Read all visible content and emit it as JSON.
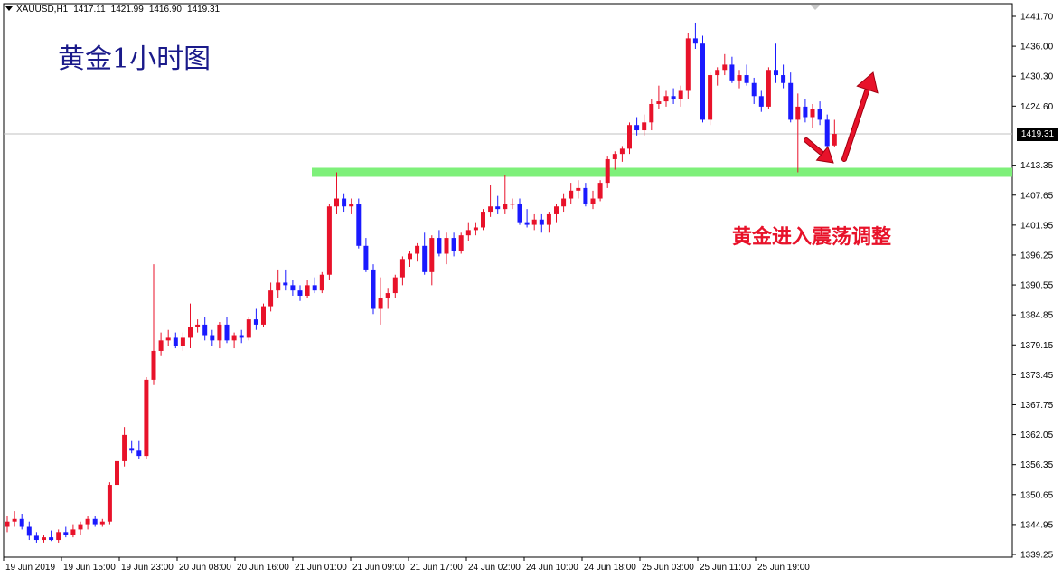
{
  "header": {
    "symbol": "XAUUSD,H1",
    "open": "1417.11",
    "high": "1421.99",
    "low": "1416.90",
    "close": "1419.31"
  },
  "title": "黄金1小时图",
  "annotation": "黄金进入震荡调整",
  "current_price_label": "1419.31",
  "colors": {
    "bull": "#e8122a",
    "bear": "#1a1aff",
    "support_line": "#7ef07a",
    "arrow": "#e8122a",
    "title": "#1a1a8a",
    "price_line": "#c0c0c0"
  },
  "chart_data": {
    "type": "candlestick",
    "y_axis": {
      "min": 1338.0,
      "max": 1443.0,
      "ticks": [
        1441.7,
        1436.0,
        1430.3,
        1424.6,
        1419.31,
        1413.35,
        1407.65,
        1401.95,
        1396.25,
        1390.55,
        1384.85,
        1379.15,
        1373.45,
        1367.75,
        1362.05,
        1356.35,
        1350.65,
        1344.95,
        1339.25
      ],
      "tick_labels": [
        "1441.70",
        "1436.00",
        "1430.30",
        "1424.60",
        "1419.31",
        "1413.35",
        "1407.65",
        "1401.95",
        "1396.25",
        "1390.55",
        "1384.85",
        "1379.15",
        "1373.45",
        "1367.75",
        "1362.05",
        "1356.35",
        "1350.65",
        "1344.95",
        "1339.25"
      ]
    },
    "x_axis": {
      "tick_labels": [
        "19 Jun 2019",
        "19 Jun 15:00",
        "19 Jun 23:00",
        "20 Jun 08:00",
        "20 Jun 16:00",
        "21 Jun 01:00",
        "21 Jun 09:00",
        "21 Jun 17:00",
        "24 Jun 02:00",
        "24 Jun 10:00",
        "24 Jun 18:00",
        "25 Jun 03:00",
        "25 Jun 11:00",
        "25 Jun 19:00"
      ],
      "tick_bar_index": [
        0,
        8,
        16,
        24,
        32,
        40,
        48,
        56,
        64,
        72,
        80,
        88,
        96,
        104
      ]
    },
    "support_level": 1412.0,
    "current_price": 1419.31,
    "candles": [
      [
        1344.5,
        1346.5,
        1343.5,
        1345.5
      ],
      [
        1345.5,
        1347.5,
        1344.5,
        1346.0
      ],
      [
        1346.0,
        1347.0,
        1344.0,
        1344.5
      ],
      [
        1344.5,
        1345.5,
        1342.0,
        1342.8
      ],
      [
        1342.8,
        1343.5,
        1341.5,
        1342.0
      ],
      [
        1342.0,
        1343.0,
        1341.5,
        1342.5
      ],
      [
        1342.5,
        1343.8,
        1341.8,
        1342.0
      ],
      [
        1342.0,
        1344.0,
        1341.5,
        1343.5
      ],
      [
        1343.5,
        1344.5,
        1342.5,
        1343.0
      ],
      [
        1343.0,
        1345.0,
        1342.5,
        1344.0
      ],
      [
        1344.0,
        1345.5,
        1343.0,
        1345.0
      ],
      [
        1345.0,
        1346.5,
        1344.0,
        1346.0
      ],
      [
        1346.0,
        1346.5,
        1344.5,
        1345.0
      ],
      [
        1345.0,
        1346.0,
        1344.5,
        1345.5
      ],
      [
        1345.5,
        1353.0,
        1345.0,
        1352.5
      ],
      [
        1352.5,
        1357.5,
        1351.5,
        1357.0
      ],
      [
        1357.0,
        1363.5,
        1356.0,
        1362.0
      ],
      [
        1359.5,
        1361.0,
        1358.5,
        1359.0
      ],
      [
        1359.0,
        1361.0,
        1357.5,
        1358.0
      ],
      [
        1358.0,
        1373.0,
        1357.5,
        1372.5
      ],
      [
        1372.5,
        1394.5,
        1371.5,
        1378.0
      ],
      [
        1378.0,
        1381.5,
        1377.0,
        1380.0
      ],
      [
        1380.0,
        1382.0,
        1379.0,
        1380.5
      ],
      [
        1380.5,
        1381.5,
        1378.5,
        1379.0
      ],
      [
        1379.0,
        1381.5,
        1378.0,
        1380.5
      ],
      [
        1380.5,
        1387.0,
        1378.5,
        1382.5
      ],
      [
        1382.5,
        1384.0,
        1381.5,
        1383.0
      ],
      [
        1383.0,
        1384.5,
        1380.0,
        1381.0
      ],
      [
        1381.0,
        1382.0,
        1379.0,
        1380.0
      ],
      [
        1380.0,
        1383.5,
        1378.5,
        1383.0
      ],
      [
        1383.0,
        1384.5,
        1379.5,
        1380.0
      ],
      [
        1380.0,
        1381.5,
        1378.5,
        1381.0
      ],
      [
        1381.0,
        1382.0,
        1379.5,
        1380.5
      ],
      [
        1380.5,
        1384.5,
        1380.0,
        1384.0
      ],
      [
        1384.0,
        1386.0,
        1382.0,
        1383.0
      ],
      [
        1383.0,
        1387.0,
        1382.5,
        1386.5
      ],
      [
        1386.5,
        1391.0,
        1385.5,
        1389.5
      ],
      [
        1389.5,
        1393.5,
        1388.0,
        1391.0
      ],
      [
        1391.0,
        1393.5,
        1389.5,
        1390.5
      ],
      [
        1390.5,
        1391.5,
        1388.5,
        1389.5
      ],
      [
        1389.5,
        1390.5,
        1387.5,
        1388.5
      ],
      [
        1388.5,
        1391.5,
        1388.0,
        1390.5
      ],
      [
        1390.5,
        1392.0,
        1389.0,
        1389.5
      ],
      [
        1389.5,
        1393.0,
        1389.0,
        1392.5
      ],
      [
        1392.5,
        1406.0,
        1391.5,
        1405.5
      ],
      [
        1405.5,
        1412.0,
        1404.0,
        1407.0
      ],
      [
        1407.0,
        1408.0,
        1404.5,
        1405.5
      ],
      [
        1405.5,
        1407.0,
        1404.0,
        1406.0
      ],
      [
        1406.0,
        1407.0,
        1397.5,
        1398.0
      ],
      [
        1398.0,
        1399.5,
        1393.0,
        1393.5
      ],
      [
        1393.5,
        1394.5,
        1385.0,
        1386.0
      ],
      [
        1386.0,
        1392.0,
        1383.0,
        1388.0
      ],
      [
        1388.0,
        1390.0,
        1386.0,
        1389.0
      ],
      [
        1389.0,
        1392.5,
        1388.0,
        1392.0
      ],
      [
        1392.0,
        1396.0,
        1390.5,
        1395.5
      ],
      [
        1395.5,
        1397.0,
        1394.0,
        1396.5
      ],
      [
        1396.5,
        1398.5,
        1395.0,
        1398.0
      ],
      [
        1398.0,
        1400.5,
        1392.5,
        1393.0
      ],
      [
        1393.0,
        1400.0,
        1390.5,
        1399.5
      ],
      [
        1399.5,
        1401.0,
        1396.0,
        1396.5
      ],
      [
        1396.5,
        1400.5,
        1394.5,
        1399.5
      ],
      [
        1399.5,
        1400.5,
        1396.0,
        1397.0
      ],
      [
        1397.0,
        1400.5,
        1396.5,
        1400.0
      ],
      [
        1400.0,
        1402.5,
        1399.0,
        1401.0
      ],
      [
        1401.0,
        1402.5,
        1400.0,
        1401.5
      ],
      [
        1401.5,
        1405.0,
        1401.0,
        1404.5
      ],
      [
        1404.5,
        1409.5,
        1403.5,
        1405.5
      ],
      [
        1405.5,
        1407.5,
        1404.0,
        1405.0
      ],
      [
        1405.0,
        1411.5,
        1404.0,
        1406.0
      ],
      [
        1406.0,
        1407.0,
        1405.0,
        1406.0
      ],
      [
        1406.0,
        1407.0,
        1402.0,
        1402.5
      ],
      [
        1402.5,
        1405.0,
        1401.5,
        1402.0
      ],
      [
        1402.0,
        1404.0,
        1401.0,
        1403.0
      ],
      [
        1403.0,
        1404.0,
        1400.5,
        1402.0
      ],
      [
        1402.0,
        1404.5,
        1400.5,
        1404.0
      ],
      [
        1404.0,
        1406.0,
        1402.5,
        1405.5
      ],
      [
        1405.5,
        1408.0,
        1404.5,
        1407.0
      ],
      [
        1407.0,
        1410.0,
        1406.0,
        1408.5
      ],
      [
        1408.5,
        1410.5,
        1407.0,
        1409.0
      ],
      [
        1409.0,
        1410.0,
        1405.5,
        1406.0
      ],
      [
        1406.0,
        1408.5,
        1405.0,
        1407.0
      ],
      [
        1407.0,
        1410.5,
        1406.5,
        1410.0
      ],
      [
        1410.0,
        1415.0,
        1409.0,
        1414.5
      ],
      [
        1414.5,
        1416.0,
        1412.5,
        1415.5
      ],
      [
        1415.5,
        1417.0,
        1414.0,
        1416.5
      ],
      [
        1416.5,
        1421.5,
        1415.5,
        1421.0
      ],
      [
        1421.0,
        1422.5,
        1419.0,
        1420.0
      ],
      [
        1420.0,
        1423.0,
        1419.0,
        1421.5
      ],
      [
        1421.5,
        1426.0,
        1420.0,
        1425.0
      ],
      [
        1425.0,
        1428.5,
        1424.0,
        1425.5
      ],
      [
        1425.5,
        1427.5,
        1424.5,
        1426.5
      ],
      [
        1426.5,
        1428.0,
        1425.0,
        1426.0
      ],
      [
        1426.0,
        1428.5,
        1424.5,
        1427.5
      ],
      [
        1427.5,
        1438.5,
        1426.0,
        1437.5
      ],
      [
        1437.5,
        1440.5,
        1435.5,
        1436.5
      ],
      [
        1436.5,
        1438.0,
        1421.5,
        1422.0
      ],
      [
        1422.0,
        1431.0,
        1421.0,
        1430.5
      ],
      [
        1430.5,
        1432.0,
        1428.5,
        1431.5
      ],
      [
        1431.5,
        1434.5,
        1430.5,
        1432.5
      ],
      [
        1432.5,
        1434.0,
        1429.0,
        1429.5
      ],
      [
        1429.5,
        1431.5,
        1428.0,
        1430.5
      ],
      [
        1430.5,
        1432.5,
        1428.5,
        1429.0
      ],
      [
        1429.0,
        1430.0,
        1425.0,
        1426.5
      ],
      [
        1426.5,
        1427.5,
        1423.5,
        1424.5
      ],
      [
        1424.5,
        1432.0,
        1424.0,
        1431.5
      ],
      [
        1431.5,
        1436.5,
        1429.0,
        1430.5
      ],
      [
        1430.5,
        1432.5,
        1428.0,
        1429.0
      ],
      [
        1429.0,
        1431.0,
        1421.5,
        1422.0
      ],
      [
        1422.0,
        1427.0,
        1412.0,
        1424.5
      ],
      [
        1424.5,
        1426.0,
        1421.5,
        1422.5
      ],
      [
        1422.5,
        1425.0,
        1420.5,
        1424.0
      ],
      [
        1424.0,
        1425.5,
        1421.0,
        1422.0
      ],
      [
        1422.0,
        1423.0,
        1416.5,
        1417.0
      ],
      [
        1417.11,
        1421.99,
        1416.9,
        1419.31
      ]
    ]
  }
}
